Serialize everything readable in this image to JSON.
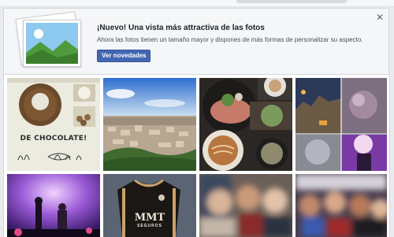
{
  "notice": {
    "title": "¡Nuevo! Una vista más attractiva de las fotos",
    "body": "Ahora las fotos tienen un tamaño mayor y dispones de más formas de personalizar su aspecto.",
    "button_label": "Ver novedades",
    "close_glyph": "✕"
  },
  "photos": [
    {
      "text": "DE CHOCOLATE!"
    },
    {
      "text": ""
    },
    {
      "text": ""
    },
    {
      "text": ""
    },
    {
      "text": ""
    },
    {
      "text": "MMT",
      "sub": "SEGUROS"
    },
    {
      "text": ""
    },
    {
      "text": ""
    }
  ],
  "colors": {
    "accent": "#4267b2",
    "background": "#e9ebee"
  },
  "icons": {
    "notice": "photo-stack-icon",
    "close": "close-icon"
  }
}
